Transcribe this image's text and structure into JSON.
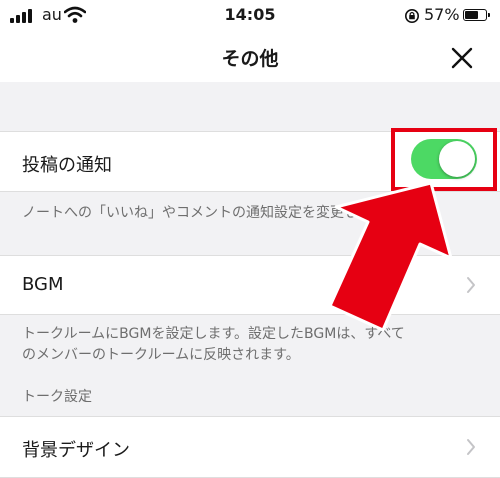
{
  "status_bar": {
    "carrier": "au",
    "time": "14:05",
    "battery_percent": "57%",
    "battery_level": 0.57,
    "icons": [
      "signal-icon",
      "wifi-icon",
      "orientation-lock-icon",
      "battery-icon"
    ]
  },
  "nav": {
    "title": "その他",
    "close_icon": "close-icon"
  },
  "settings": {
    "post_notification": {
      "label": "投稿の通知",
      "enabled": true,
      "note": "ノートへの「いいね」やコメントの通知設定を変更します。"
    },
    "bgm": {
      "label": "BGM",
      "note_line1": "トークルームにBGMを設定します。設定したBGMは、すべて",
      "note_line2": "のメンバーのトークルームに反映されます。"
    },
    "talk_section_header": "トーク設定",
    "background_design": {
      "label": "背景デザイン"
    }
  },
  "annotation": {
    "highlight_color": "#e60012",
    "arrow_icon": "red-arrow-icon"
  },
  "colors": {
    "toggle_on": "#4cd964",
    "background": "#f2f2f4"
  }
}
